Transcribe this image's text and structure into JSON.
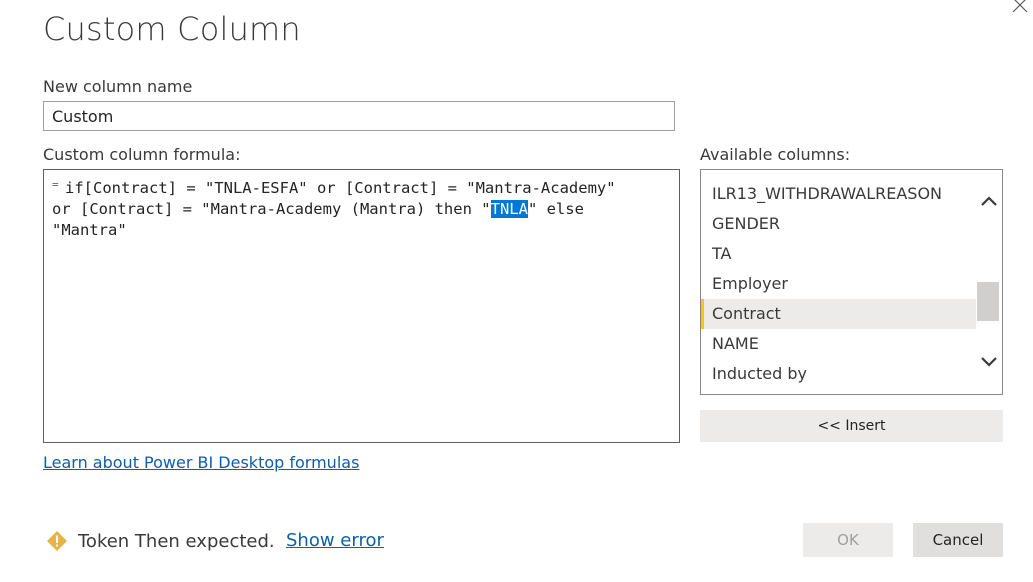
{
  "dialog": {
    "title": "Custom Column",
    "close_icon": "close-icon"
  },
  "new_column": {
    "label": "New column name",
    "value": "Custom"
  },
  "formula": {
    "label": "Custom column formula:",
    "equals_sign": "=",
    "line1": "if[Contract] = \"TNLA-ESFA\" or [Contract] = \"Mantra-Academy\"",
    "line2_before": "or [Contract] = \"Mantra-Academy (Mantra) then \"",
    "line2_selected": "TNLA",
    "line2_after": "\" else",
    "line3": "\"Mantra\""
  },
  "available_columns": {
    "label": "Available columns:",
    "items": [
      "ILR13_WITHDRAWALREASON",
      "GENDER",
      "TA",
      "Employer",
      "Contract",
      "NAME",
      "Inducted by"
    ],
    "selected": "Contract",
    "scroll_up_icon": "chevron-up-icon",
    "scroll_down_icon": "chevron-down-icon"
  },
  "insert_button": "<< Insert",
  "learn_link": "Learn about Power BI Desktop formulas",
  "status": {
    "icon": "warning-diamond-icon",
    "message": "Token Then expected.",
    "show_error_link": "Show error",
    "warning_color": "#e8b24a"
  },
  "buttons": {
    "ok": "OK",
    "cancel": "Cancel"
  },
  "colors": {
    "selection": "#0078d4",
    "column_marker": "#f2c811",
    "link": "#0f5ea8"
  }
}
